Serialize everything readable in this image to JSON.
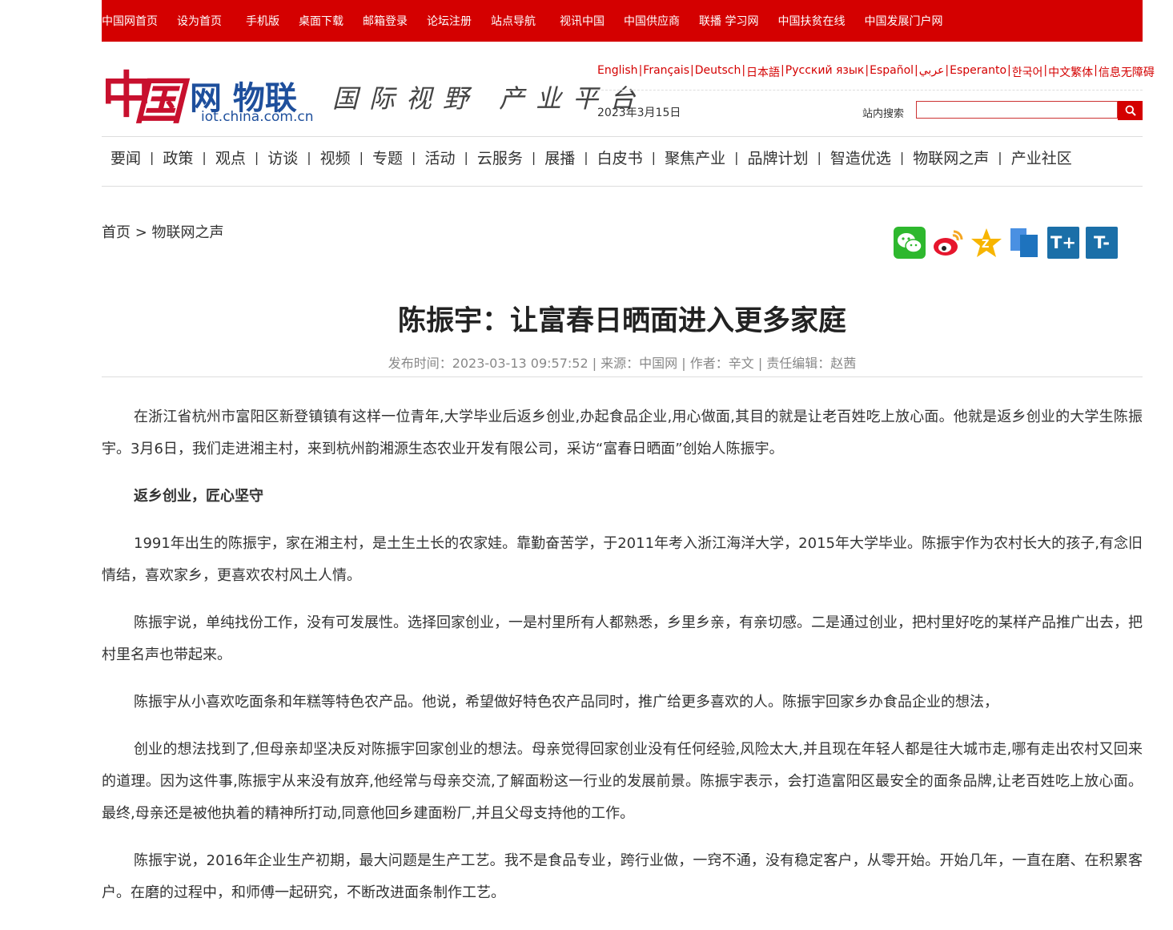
{
  "topnav": [
    "中国网首页",
    "设为首页",
    "手机版",
    "桌面下载",
    "邮箱登录",
    "论坛注册",
    "站点导航",
    "视讯中国",
    "中国供应商",
    "联播 学习网",
    "中国扶贫在线",
    "中国发展门户网"
  ],
  "logo": {
    "main": "网 物联",
    "url": "iot.china.com.cn"
  },
  "slogan": "国际视野 产业平台",
  "languages": [
    "English",
    "Français",
    "Deutsch",
    "日本語",
    "Русский язык",
    "Español",
    "عربي",
    "Esperanto",
    "한국어",
    "中文繁体",
    "信息无障碍"
  ],
  "date": "2023年3月15日",
  "search": {
    "label": "站内搜索",
    "value": "",
    "placeholder": ""
  },
  "mainnav": [
    "要闻",
    "政策",
    "观点",
    "访谈",
    "视频",
    "专题",
    "活动",
    "云服务",
    "展播",
    "白皮书",
    "聚焦产业",
    "品牌计划",
    "智造优选",
    "物联网之声",
    "产业社区"
  ],
  "breadcrumb": {
    "home": "首页",
    "sep": " > ",
    "current": "物联网之声"
  },
  "share": {
    "font_up": "T+",
    "font_down": "T-"
  },
  "article": {
    "title": "陈振宇：让富春日晒面进入更多家庭",
    "meta": "发布时间：2023-03-13 09:57:52 | 来源：中国网 | 作者：辛文 | 责任编辑：赵茜",
    "paragraphs": [
      "在浙江省杭州市富阳区新登镇镇有这样一位青年,大学毕业后返乡创业,办起食品企业,用心做面,其目的就是让老百姓吃上放心面。他就是返乡创业的大学生陈振宇。3月6日，我们走进湘主村，来到杭州韵湘源生态农业开发有限公司，采访“富春日晒面”创始人陈振宇。",
      "返乡创业，匠心坚守",
      "1991年出生的陈振宇，家在湘主村，是土生土长的农家娃。靠勤奋苦学，于2011年考入浙江海洋大学，2015年大学毕业。陈振宇作为农村长大的孩子,有念旧情结，喜欢家乡，更喜欢农村风土人情。",
      "陈振宇说，单纯找份工作，没有可发展性。选择回家创业，一是村里所有人都熟悉，乡里乡亲，有亲切感。二是通过创业，把村里好吃的某样产品推广出去，把村里名声也带起来。",
      "陈振宇从小喜欢吃面条和年糕等特色农产品。他说，希望做好特色农产品同时，推广给更多喜欢的人。陈振宇回家乡办食品企业的想法，",
      "创业的想法找到了,但母亲却坚决反对陈振宇回家创业的想法。母亲觉得回家创业没有任何经验,风险太大,并且现在年轻人都是往大城市走,哪有走出农村又回来的道理。因为这件事,陈振宇从来没有放弃,他经常与母亲交流,了解面粉这一行业的发展前景。陈振宇表示，会打造富阳区最安全的面条品牌,让老百姓吃上放心面。最终,母亲还是被他执着的精神所打动,同意他回乡建面粉厂,并且父母支持他的工作。",
      "陈振宇说，2016年企业生产初期，最大问题是生产工艺。我不是食品专业，跨行业做，一窍不通，没有稳定客户，从零开始。开始几年，一直在磨、在积累客户。在磨的过程中，和师傅一起研究，不断改进面条制作工艺。"
    ]
  }
}
